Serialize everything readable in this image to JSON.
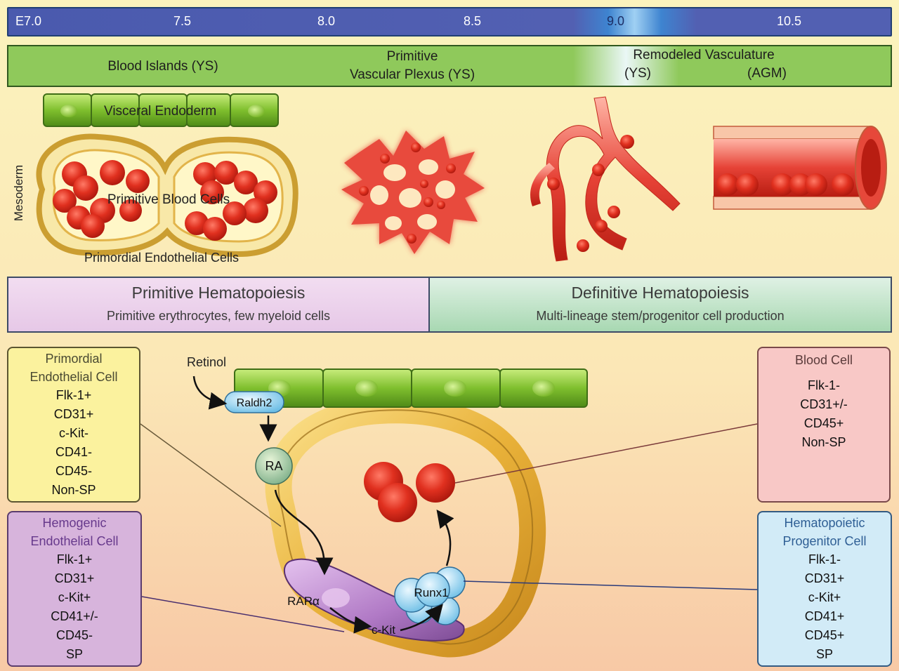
{
  "timeline": {
    "ticks": [
      "E7.0",
      "7.5",
      "8.0",
      "8.5",
      "9.0",
      "10.5"
    ]
  },
  "stages": {
    "blood_islands": "Blood Islands (YS)",
    "plexus_line1": "Primitive",
    "plexus_line2": "Vascular Plexus (YS)",
    "remodeled": "Remodeled Vasculature",
    "remodeled_ys": "(YS)",
    "remodeled_agm": "(AGM)"
  },
  "upper_labels": {
    "visceral_endoderm": "Visceral Endoderm",
    "mesoderm": "Mesoderm",
    "primitive_blood_cells": "Primitive Blood Cells",
    "primordial_endothelial_cells": "Primordial Endothelial Cells"
  },
  "hematopoiesis": {
    "primitive_title": "Primitive Hematopoiesis",
    "primitive_sub": "Primitive erythrocytes, few myeloid cells",
    "definitive_title": "Definitive Hematopoiesis",
    "definitive_sub": "Multi-lineage stem/progenitor cell production"
  },
  "boxes": {
    "primordial": {
      "title1": "Primordial",
      "title2": "Endothelial Cell",
      "markers": [
        "Flk-1+",
        "CD31+",
        "c-Kit-",
        "CD41-",
        "CD45-",
        "Non-SP"
      ]
    },
    "hemogenic": {
      "title1": "Hemogenic",
      "title2": "Endothelial Cell",
      "markers": [
        "Flk-1+",
        "CD31+",
        "c-Kit+",
        "CD41+/-",
        "CD45-",
        "SP"
      ]
    },
    "blood": {
      "title1": "Blood Cell",
      "markers": [
        "Flk-1-",
        "CD31+/-",
        "CD45+",
        "Non-SP"
      ]
    },
    "hsc": {
      "title1": "Hematopoietic",
      "title2": "Progenitor Cell",
      "markers": [
        "Flk-1-",
        "CD31+",
        "c-Kit+",
        "CD41+",
        "CD45+",
        "SP"
      ]
    }
  },
  "pathway": {
    "retinol": "Retinol",
    "raldh2": "Raldh2",
    "ra": "RA",
    "rara": "RARα",
    "ckit": "c-Kit",
    "runx1": "Runx1"
  },
  "colors": {
    "red_cell": "#e23a2c",
    "vessel_wall": "#e8b53c",
    "endoderm": "#8fcf3c",
    "hemogenic": "#b57fc4",
    "runx1": "#8dd3f0"
  }
}
